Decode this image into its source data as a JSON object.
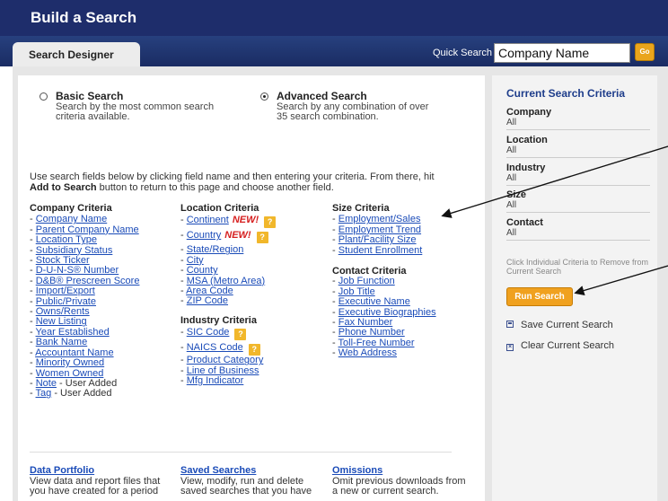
{
  "header": {
    "title": "Build a Search"
  },
  "tabs": {
    "search_designer": "Search Designer"
  },
  "quick_search": {
    "label": "Quick Search",
    "value": "Company Name",
    "go_label": "Go"
  },
  "search_types": {
    "basic": {
      "title": "Basic Search",
      "desc": "Search by the most common search criteria available.",
      "selected": false
    },
    "advanced": {
      "title": "Advanced Search",
      "desc": "Search by any combination of over 35 search combination.",
      "selected": true
    }
  },
  "instructions": {
    "part1": "Use search fields below by clicking field name and then entering your criteria. From there, hit ",
    "bold1": "Add to Search",
    "part2": " button to return to this page and choose another field."
  },
  "company_criteria": {
    "heading": "Company Criteria",
    "items": [
      "Company Name",
      "Parent Company Name",
      "Location Type",
      "Subsidiary Status",
      "Stock Ticker",
      "D-U-N-S® Number",
      "D&B® Prescreen Score",
      "Import/Export",
      "Public/Private",
      "Owns/Rents",
      "New Listing",
      "Year Established",
      "Bank Name",
      "Accountant Name",
      "Minority Owned",
      "Women Owned"
    ],
    "user_items": [
      {
        "label": "Note",
        "suffix": " - User Added"
      },
      {
        "label": "Tag",
        "suffix": " - User Added"
      }
    ]
  },
  "location_criteria": {
    "heading": "Location Criteria",
    "new_label": "NEW!",
    "help_glyph": "?",
    "items": [
      "Continent",
      "Country",
      "State/Region",
      "City",
      "County",
      "MSA (Metro Area)",
      "Area Code",
      "ZIP Code"
    ]
  },
  "industry_criteria": {
    "heading": "Industry Criteria",
    "items": [
      "SIC Code",
      "NAICS Code",
      "Product Category",
      "Line of Business",
      "Mfg Indicator"
    ]
  },
  "size_criteria": {
    "heading": "Size Criteria",
    "items": [
      "Employment/Sales",
      "Employment Trend",
      "Plant/Facility Size",
      "Student Enrollment"
    ]
  },
  "contact_criteria": {
    "heading": "Contact Criteria",
    "items": [
      "Job Function",
      "Job Title",
      "Executive Name",
      "Executive Biographies",
      "Fax Number",
      "Phone Number",
      "Toll-Free Number",
      "Web Address"
    ]
  },
  "footer_links": [
    {
      "title": "Data Portfolio",
      "desc": "View data and report files that you have created for a period"
    },
    {
      "title": "Saved Searches",
      "desc": "View, modify, run and delete saved searches that you have"
    },
    {
      "title": "Omissions",
      "desc": "Omit previous downloads from a new or current search."
    }
  ],
  "current_criteria": {
    "title": "Current Search Criteria",
    "items": [
      {
        "label": "Company",
        "value": "All"
      },
      {
        "label": "Location",
        "value": "All"
      },
      {
        "label": "Industry",
        "value": "All"
      },
      {
        "label": "Size",
        "value": "All"
      },
      {
        "label": "Contact",
        "value": "All"
      }
    ],
    "hint": "Click Individual Criteria to Remove from Current Search",
    "run_label": "Run Search",
    "save_label": "Save Current Search",
    "clear_label": "Clear Current Search"
  }
}
